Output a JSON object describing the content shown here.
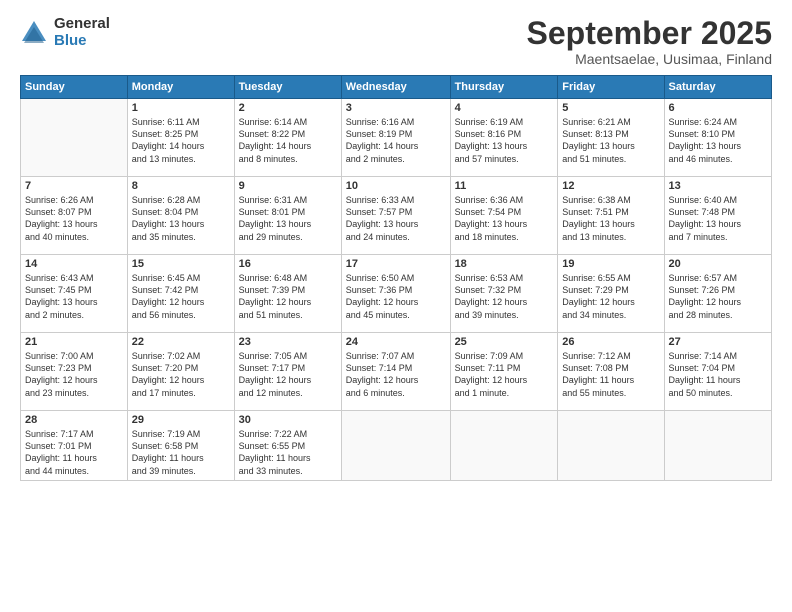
{
  "logo": {
    "general": "General",
    "blue": "Blue"
  },
  "header": {
    "month": "September 2025",
    "location": "Maentsaelae, Uusimaa, Finland"
  },
  "weekdays": [
    "Sunday",
    "Monday",
    "Tuesday",
    "Wednesday",
    "Thursday",
    "Friday",
    "Saturday"
  ],
  "weeks": [
    [
      {
        "day": "",
        "info": ""
      },
      {
        "day": "1",
        "info": "Sunrise: 6:11 AM\nSunset: 8:25 PM\nDaylight: 14 hours\nand 13 minutes."
      },
      {
        "day": "2",
        "info": "Sunrise: 6:14 AM\nSunset: 8:22 PM\nDaylight: 14 hours\nand 8 minutes."
      },
      {
        "day": "3",
        "info": "Sunrise: 6:16 AM\nSunset: 8:19 PM\nDaylight: 14 hours\nand 2 minutes."
      },
      {
        "day": "4",
        "info": "Sunrise: 6:19 AM\nSunset: 8:16 PM\nDaylight: 13 hours\nand 57 minutes."
      },
      {
        "day": "5",
        "info": "Sunrise: 6:21 AM\nSunset: 8:13 PM\nDaylight: 13 hours\nand 51 minutes."
      },
      {
        "day": "6",
        "info": "Sunrise: 6:24 AM\nSunset: 8:10 PM\nDaylight: 13 hours\nand 46 minutes."
      }
    ],
    [
      {
        "day": "7",
        "info": "Sunrise: 6:26 AM\nSunset: 8:07 PM\nDaylight: 13 hours\nand 40 minutes."
      },
      {
        "day": "8",
        "info": "Sunrise: 6:28 AM\nSunset: 8:04 PM\nDaylight: 13 hours\nand 35 minutes."
      },
      {
        "day": "9",
        "info": "Sunrise: 6:31 AM\nSunset: 8:01 PM\nDaylight: 13 hours\nand 29 minutes."
      },
      {
        "day": "10",
        "info": "Sunrise: 6:33 AM\nSunset: 7:57 PM\nDaylight: 13 hours\nand 24 minutes."
      },
      {
        "day": "11",
        "info": "Sunrise: 6:36 AM\nSunset: 7:54 PM\nDaylight: 13 hours\nand 18 minutes."
      },
      {
        "day": "12",
        "info": "Sunrise: 6:38 AM\nSunset: 7:51 PM\nDaylight: 13 hours\nand 13 minutes."
      },
      {
        "day": "13",
        "info": "Sunrise: 6:40 AM\nSunset: 7:48 PM\nDaylight: 13 hours\nand 7 minutes."
      }
    ],
    [
      {
        "day": "14",
        "info": "Sunrise: 6:43 AM\nSunset: 7:45 PM\nDaylight: 13 hours\nand 2 minutes."
      },
      {
        "day": "15",
        "info": "Sunrise: 6:45 AM\nSunset: 7:42 PM\nDaylight: 12 hours\nand 56 minutes."
      },
      {
        "day": "16",
        "info": "Sunrise: 6:48 AM\nSunset: 7:39 PM\nDaylight: 12 hours\nand 51 minutes."
      },
      {
        "day": "17",
        "info": "Sunrise: 6:50 AM\nSunset: 7:36 PM\nDaylight: 12 hours\nand 45 minutes."
      },
      {
        "day": "18",
        "info": "Sunrise: 6:53 AM\nSunset: 7:32 PM\nDaylight: 12 hours\nand 39 minutes."
      },
      {
        "day": "19",
        "info": "Sunrise: 6:55 AM\nSunset: 7:29 PM\nDaylight: 12 hours\nand 34 minutes."
      },
      {
        "day": "20",
        "info": "Sunrise: 6:57 AM\nSunset: 7:26 PM\nDaylight: 12 hours\nand 28 minutes."
      }
    ],
    [
      {
        "day": "21",
        "info": "Sunrise: 7:00 AM\nSunset: 7:23 PM\nDaylight: 12 hours\nand 23 minutes."
      },
      {
        "day": "22",
        "info": "Sunrise: 7:02 AM\nSunset: 7:20 PM\nDaylight: 12 hours\nand 17 minutes."
      },
      {
        "day": "23",
        "info": "Sunrise: 7:05 AM\nSunset: 7:17 PM\nDaylight: 12 hours\nand 12 minutes."
      },
      {
        "day": "24",
        "info": "Sunrise: 7:07 AM\nSunset: 7:14 PM\nDaylight: 12 hours\nand 6 minutes."
      },
      {
        "day": "25",
        "info": "Sunrise: 7:09 AM\nSunset: 7:11 PM\nDaylight: 12 hours\nand 1 minute."
      },
      {
        "day": "26",
        "info": "Sunrise: 7:12 AM\nSunset: 7:08 PM\nDaylight: 11 hours\nand 55 minutes."
      },
      {
        "day": "27",
        "info": "Sunrise: 7:14 AM\nSunset: 7:04 PM\nDaylight: 11 hours\nand 50 minutes."
      }
    ],
    [
      {
        "day": "28",
        "info": "Sunrise: 7:17 AM\nSunset: 7:01 PM\nDaylight: 11 hours\nand 44 minutes."
      },
      {
        "day": "29",
        "info": "Sunrise: 7:19 AM\nSunset: 6:58 PM\nDaylight: 11 hours\nand 39 minutes."
      },
      {
        "day": "30",
        "info": "Sunrise: 7:22 AM\nSunset: 6:55 PM\nDaylight: 11 hours\nand 33 minutes."
      },
      {
        "day": "",
        "info": ""
      },
      {
        "day": "",
        "info": ""
      },
      {
        "day": "",
        "info": ""
      },
      {
        "day": "",
        "info": ""
      }
    ]
  ]
}
